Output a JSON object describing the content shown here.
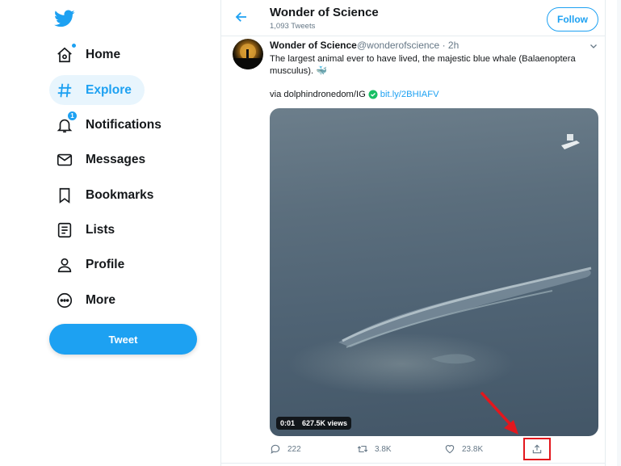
{
  "sidebar": {
    "logo_icon": "twitter-bird-icon",
    "items": [
      {
        "label": "Home",
        "icon": "home-icon"
      },
      {
        "label": "Explore",
        "icon": "hashtag-icon"
      },
      {
        "label": "Notifications",
        "icon": "bell-icon",
        "badge": "1"
      },
      {
        "label": "Messages",
        "icon": "envelope-icon"
      },
      {
        "label": "Bookmarks",
        "icon": "bookmark-icon"
      },
      {
        "label": "Lists",
        "icon": "list-icon"
      },
      {
        "label": "Profile",
        "icon": "person-icon"
      },
      {
        "label": "More",
        "icon": "more-circle-icon"
      }
    ],
    "active_item": "Explore",
    "tweet_button": "Tweet"
  },
  "header": {
    "title": "Wonder of Science",
    "subtitle": "1,093 Tweets",
    "follow_button": "Follow"
  },
  "tweet": {
    "author_name": "Wonder of Science",
    "author_handle": "@wonderofscience · 2h",
    "text": "The largest animal ever to have lived, the majestic blue whale (Balaenoptera musculus).",
    "emoji": "🐳",
    "via_prefix": "via dolphindronedom/IG",
    "link": "bit.ly/2BHIAFV",
    "video_time": "0:01",
    "video_views": "627.5K views",
    "replies": "222",
    "retweets": "3.8K",
    "likes": "23.8K"
  },
  "colors": {
    "accent": "#1da1f2",
    "annotation": "#e3171d",
    "verified": "#17bf63"
  }
}
